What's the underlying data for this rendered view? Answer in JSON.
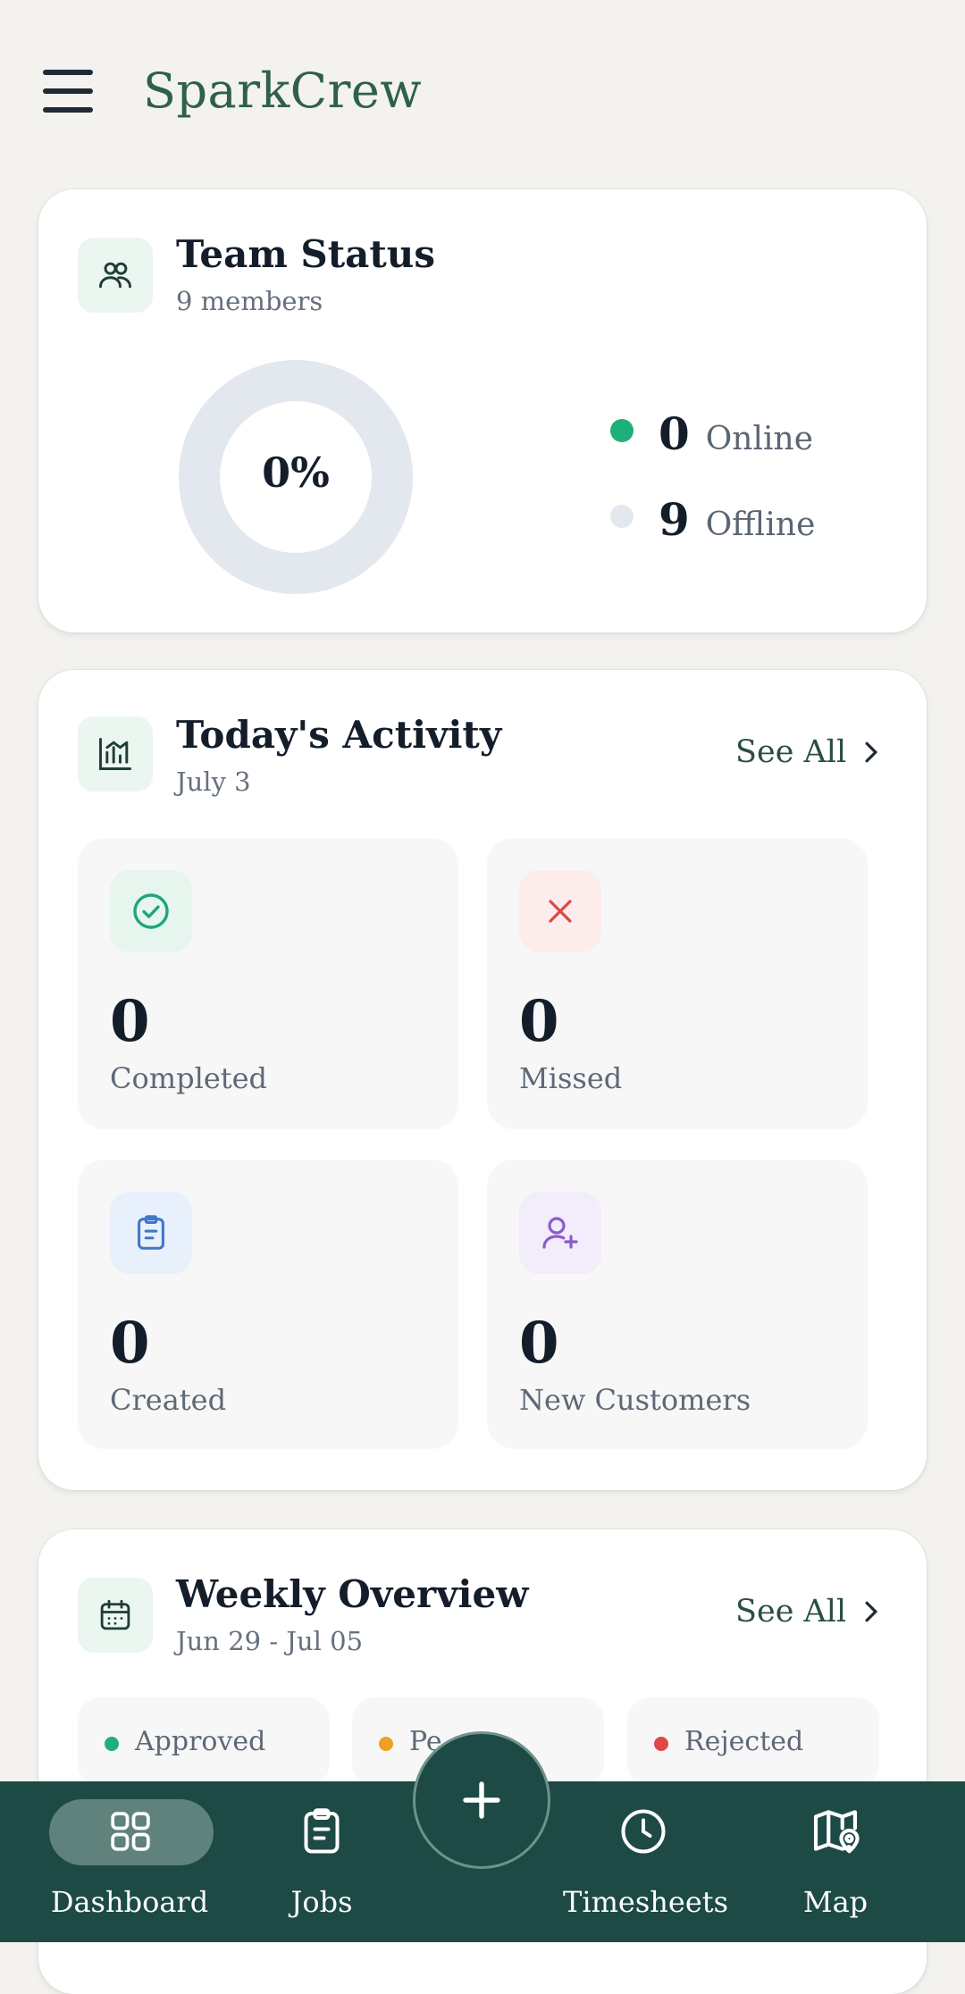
{
  "header": {
    "app_title": "SparkCrew",
    "menu_icon": "hamburger-icon"
  },
  "team_status": {
    "title": "Team Status",
    "subtitle": "9 members",
    "online_percent_label": "0%",
    "online_fraction": 0,
    "online": {
      "count": "0",
      "label": "Online",
      "color": "#1fb07a"
    },
    "offline": {
      "count": "9",
      "label": "Offline",
      "color": "#e3e7ee"
    }
  },
  "activity": {
    "title": "Today's Activity",
    "date": "July 3",
    "see_all": "See All",
    "tiles": [
      {
        "value": "0",
        "label": "Completed",
        "icon": "check-circle-icon"
      },
      {
        "value": "0",
        "label": "Missed",
        "icon": "x-icon"
      },
      {
        "value": "0",
        "label": "Created",
        "icon": "clipboard-icon"
      },
      {
        "value": "0",
        "label": "New Customers",
        "icon": "user-plus-icon"
      }
    ]
  },
  "weekly": {
    "title": "Weekly Overview",
    "range": "Jun 29 - Jul 05",
    "see_all": "See All",
    "chips": [
      {
        "label": "Approved",
        "color": "#1fb07a"
      },
      {
        "label": "Pe",
        "color": "#f0a020"
      },
      {
        "label": "Rejected",
        "color": "#e04848"
      }
    ]
  },
  "nav": {
    "items": [
      {
        "label": "Dashboard",
        "icon": "grid-icon",
        "active": true
      },
      {
        "label": "Jobs",
        "icon": "clipboard-icon"
      },
      {
        "label": "Timesheets",
        "icon": "clock-icon"
      },
      {
        "label": "Map",
        "icon": "map-pin-icon"
      }
    ],
    "fab_icon": "plus-icon"
  },
  "colors": {
    "brand": "#2f5f4f",
    "nav_bg": "#1d4a44",
    "accent_green": "#1fb07a",
    "missed_red": "#e04848"
  }
}
